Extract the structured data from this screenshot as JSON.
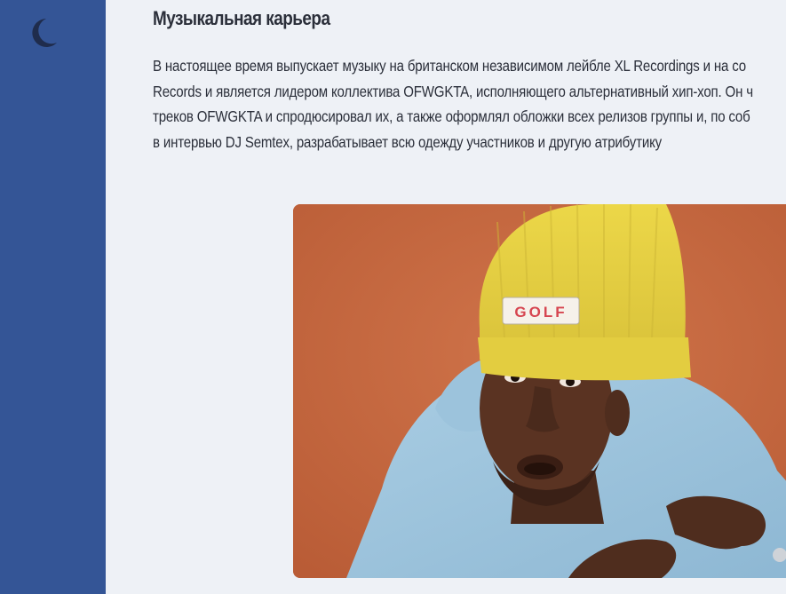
{
  "sidebar": {
    "theme_toggle_icon": "moon-icon",
    "background": "#345596",
    "icon_color": "#1f2c4c"
  },
  "article": {
    "title": "Музыкальная карьера",
    "paragraph_lines": [
      "В настоящее время выпускает музыку на британском независимом лейбле XL Recordings и на со",
      "Records и является лидером коллектива OFWGKTA, исполняющего альтернативный хип-хоп. Он ч",
      "треков OFWGKTA и спродюсировал их, а также оформлял обложки всех релизов группы и, по соб",
      "в интервью DJ Semtex, разрабатывает всю одежду участников и другую атрибутику"
    ],
    "text_color": "#2b2f3a"
  },
  "photo": {
    "hat_label": "GOLF",
    "background": "#c5673e"
  },
  "page": {
    "background": "#eef1f6"
  }
}
